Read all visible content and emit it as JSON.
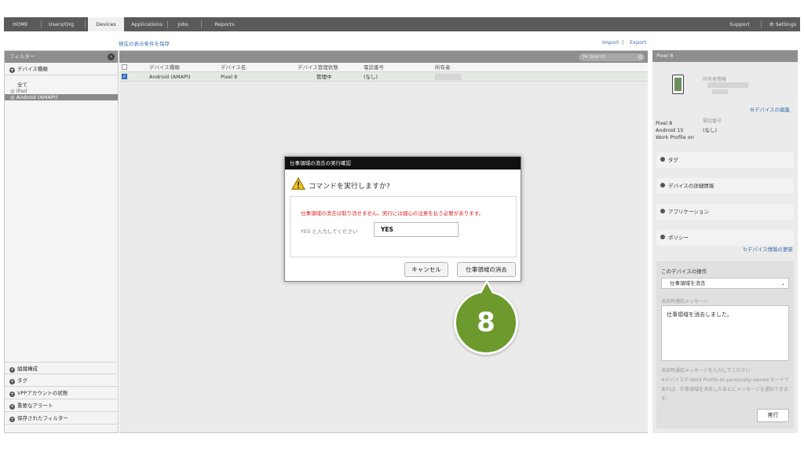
{
  "nav": {
    "tabs": [
      "HOME",
      "Users/Org",
      "Devices",
      "Applications",
      "Jobs",
      "Reports"
    ],
    "support": "Support",
    "settings": "Settings"
  },
  "subbar": {
    "save_view": "現在の表示条件を保存",
    "import": "Import",
    "separator": "|",
    "export": "Export"
  },
  "left": {
    "header": "フィルター",
    "device_type_section": "デバイス種類",
    "filter_items": [
      "全て",
      "iPad",
      "Android (AMAPI)"
    ],
    "bottom_sections": [
      "組織構成",
      "タグ",
      "VPPアカウントの状態",
      "重要なアラート",
      "保存されたフィルター"
    ]
  },
  "grid": {
    "search_placeholder": "Search",
    "columns": [
      "デバイス種類",
      "デバイス名",
      "デバイス管理状態",
      "電話番号",
      "所有者"
    ],
    "rows": [
      {
        "type": "Android (AMAPI)",
        "name": "Pixel 8",
        "status": "管理中",
        "phone": "(なし)",
        "checked": true
      }
    ]
  },
  "right": {
    "header": "Pixel 8",
    "owner_label": "所有者情報",
    "edit_device": "デバイスの編集",
    "device_name": "Pixel 8",
    "os": "Android 15",
    "profile": "Work Profile on",
    "phone_label": "電話番号",
    "phone_value": "(なし)",
    "sections": [
      "タグ",
      "デバイスの詳細情報",
      "アプリケーション",
      "ポリシー"
    ],
    "refresh": "デバイス情報の更新",
    "ops_title": "このデバイスの操作",
    "ops_select": "仕事領域を消去",
    "msg_label": "消去時通知メッセージ",
    "msg_value": "仕事領域を消去しました。",
    "hint": "消去時通知メッセージを入力してください",
    "note": "※デバイスが Work Profile on personally-owned モードであれば、仕事領域を消去したあとにメッセージを通知できます。",
    "execute": "実行"
  },
  "dialog": {
    "title": "仕事領域の消去の実行確認",
    "question": "コマンドを実行しますか?",
    "warning": "仕事領域の消去は取り消せません。実行には細心の注意を払う必要があります。",
    "input_label": "YES と入力してください",
    "input_value": "YES",
    "cancel": "キャンセル",
    "confirm": "仕事領域の消去"
  },
  "step_badge": "8",
  "colors": {
    "nav_bg": "#5a5a5a",
    "badge": "#6c9a2d",
    "warning_text": "#e02020",
    "link": "#3a6fb0"
  }
}
